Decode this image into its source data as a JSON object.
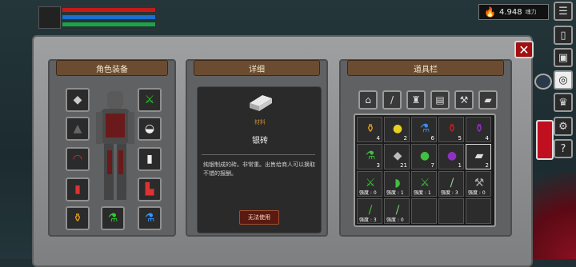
{
  "hud": {
    "currency_value": "4.948",
    "currency_unit": "魂力"
  },
  "panels": {
    "equipment_title": "角色装备",
    "detail_title": "详细",
    "inventory_title": "道具栏"
  },
  "detail": {
    "category": "材料",
    "item_name": "银砖",
    "description": "纯银制成的砖。非常重。出售给商人可以换取不错的报酬。",
    "use_button": "无法使用"
  },
  "inventory": {
    "rows": [
      [
        {
          "icon": "orange-potion",
          "count": "4"
        },
        {
          "icon": "yellow-potion",
          "count": "2"
        },
        {
          "icon": "blue-potion",
          "count": "6"
        },
        {
          "icon": "red-potion",
          "count": "5"
        },
        {
          "icon": "purple-potion",
          "count": "4"
        }
      ],
      [
        {
          "icon": "green-flask",
          "count": "3"
        },
        {
          "icon": "stone",
          "count": "21"
        },
        {
          "icon": "green-round-flask",
          "count": "7"
        },
        {
          "icon": "purple-flask",
          "count": "1"
        },
        {
          "icon": "silver-brick",
          "count": "2"
        }
      ],
      [
        {
          "icon": "green-sword",
          "level": "强度 : 0"
        },
        {
          "icon": "green-bow",
          "level": "强度 : 1"
        },
        {
          "icon": "green-dagger",
          "level": "强度 : 1"
        },
        {
          "icon": "green-spear",
          "level": "强度 : 3"
        },
        {
          "icon": "grey-axe",
          "level": "强度 : 0"
        }
      ],
      [
        {
          "icon": "green-blade",
          "level": "强度 : 3"
        },
        {
          "icon": "green-club",
          "level": "强度 : 0"
        },
        {
          "icon": "empty"
        },
        {
          "icon": "empty"
        },
        {
          "icon": "empty"
        }
      ]
    ]
  },
  "colors": {
    "accent_red": "#a01010",
    "header_brown": "#6b4c30",
    "hp": "#c41a1a",
    "mp": "#1a6fd0",
    "xp": "#1ea246"
  }
}
